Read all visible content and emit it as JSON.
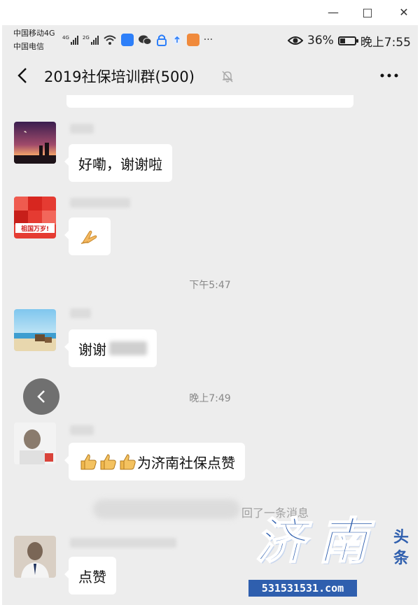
{
  "window": {
    "min_icon": "minimize-icon",
    "max_icon": "maximize-icon",
    "close_icon": "close-icon"
  },
  "statusbar": {
    "carrier1": "中国移动4G",
    "carrier2": "中国电信",
    "signal1_label": "4G",
    "signal2_label": "2G",
    "battery_text": "36%",
    "battery_level": 0.36,
    "time": "晚上7:55",
    "more_indicator": "···"
  },
  "header": {
    "title": "2019社保培训群(500)",
    "back_icon": "back-chevron-icon",
    "mute_icon": "muted-bell-icon",
    "more_icon": "more-dots-icon"
  },
  "messages": [
    {
      "text": "好嘞，谢谢啦"
    },
    {
      "emoji": "folded-hands-emoji"
    },
    {
      "timestamp": "下午5:47"
    },
    {
      "text": "谢谢"
    },
    {
      "timestamp": "晚上7:49"
    },
    {
      "text": "为济南社保点赞",
      "emoji": "thumbs-up-emoji"
    },
    {
      "system": "回了一条消息"
    },
    {
      "text": "点赞"
    }
  ],
  "avatar2_banner": "祖国万岁!",
  "watermark": {
    "big1": "济",
    "big2": "南",
    "small1": "头",
    "small2": "条",
    "url": "531531531.com"
  }
}
